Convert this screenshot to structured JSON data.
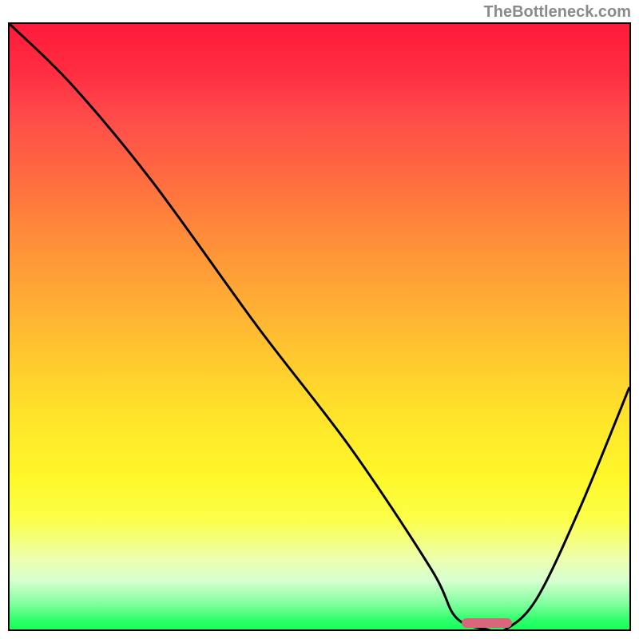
{
  "attribution": "TheBottleneck.com",
  "chart_data": {
    "type": "line",
    "title": "",
    "xlabel": "",
    "ylabel": "",
    "xlim": [
      0,
      100
    ],
    "ylim": [
      0,
      100
    ],
    "series": [
      {
        "name": "bottleneck-curve",
        "x": [
          0,
          10,
          23,
          40,
          55,
          68,
          72,
          77,
          80,
          85,
          92,
          100
        ],
        "y": [
          100,
          90,
          74,
          50,
          30,
          10,
          2,
          0,
          0,
          5,
          20,
          40
        ]
      }
    ],
    "optimum_marker": {
      "x_start": 73,
      "x_end": 81,
      "y": 0,
      "color": "#d9667a"
    },
    "background": {
      "type": "vertical-gradient",
      "stops": [
        {
          "pos": 0.0,
          "color": "#ff1a3a"
        },
        {
          "pos": 0.5,
          "color": "#ffc82f"
        },
        {
          "pos": 0.8,
          "color": "#fff82a"
        },
        {
          "pos": 1.0,
          "color": "#1aff5a"
        }
      ]
    }
  },
  "layout": {
    "marker_left_pct": 73,
    "marker_width_pct": 8,
    "marker_bottom_px": 2,
    "marker_height_px": 12
  }
}
